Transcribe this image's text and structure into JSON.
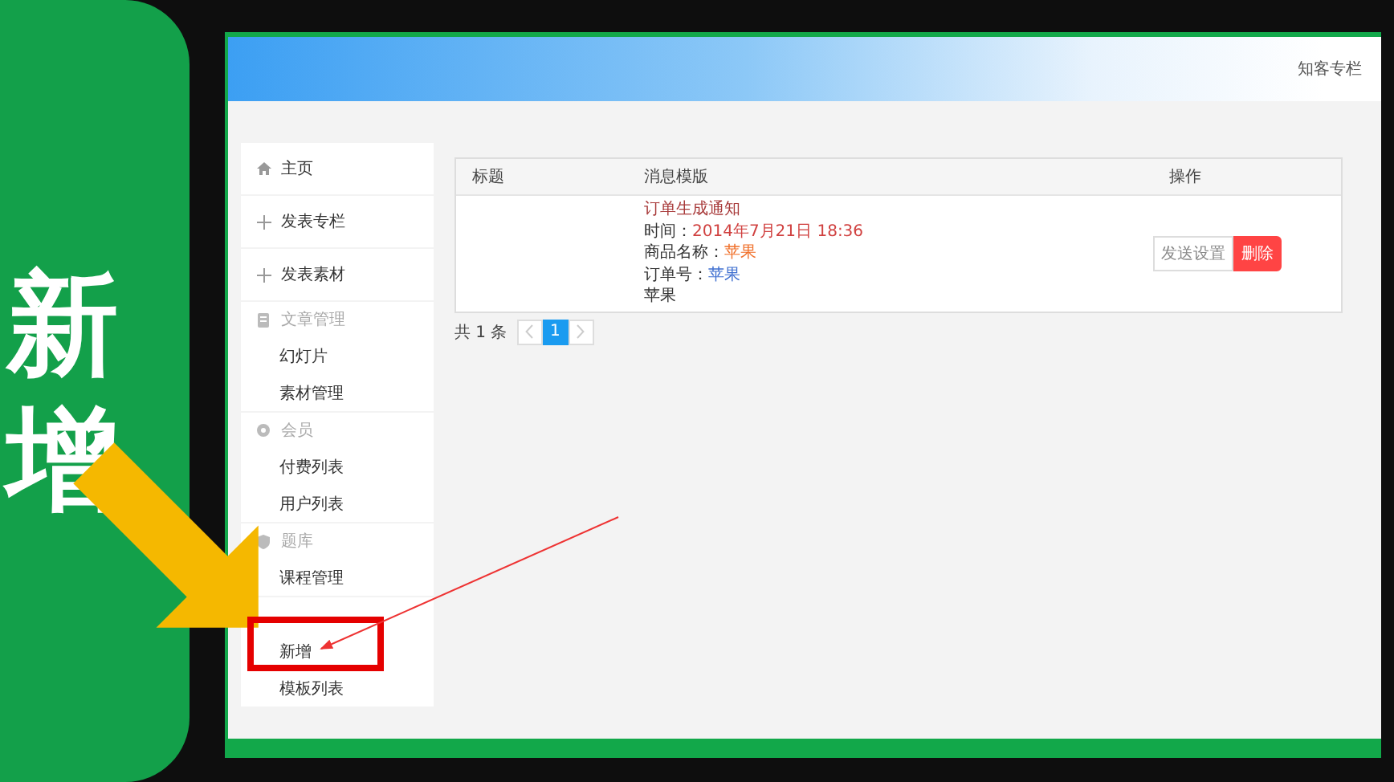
{
  "badge": {
    "text": "新增"
  },
  "header": {
    "site_name": "知客专栏"
  },
  "sidebar": {
    "items": [
      {
        "kind": "link",
        "label": "主页"
      },
      {
        "kind": "link",
        "label": "发表专栏"
      },
      {
        "kind": "link",
        "label": "发表素材"
      },
      {
        "kind": "group",
        "label": "文章管理",
        "children": [
          {
            "label": "幻灯片"
          },
          {
            "label": "素材管理"
          }
        ]
      },
      {
        "kind": "group",
        "label": "会员",
        "children": [
          {
            "label": "付费列表"
          },
          {
            "label": "用户列表"
          }
        ]
      },
      {
        "kind": "group",
        "label": "题库",
        "children": [
          {
            "label": "课程管理"
          }
        ]
      },
      {
        "kind": "group",
        "children": [
          {
            "label": "新增"
          },
          {
            "label": "模板列表"
          }
        ]
      }
    ]
  },
  "table": {
    "columns": [
      "标题",
      "消息模版",
      "操作"
    ],
    "rows": [
      {
        "template": [
          {
            "label": "订单生成通知",
            "color": "#a83a3a"
          },
          {
            "label": "时间：",
            "value": "2014年7月21日 18:36",
            "color": "#d0403f"
          },
          {
            "label": "商品名称：",
            "value": "苹果",
            "color": "#f0702a"
          },
          {
            "label": "订单号：",
            "value": "苹果",
            "color": "#3f6fd0"
          },
          {
            "label": "苹果",
            "color": "#333333"
          }
        ],
        "actions": [
          {
            "kind": "default",
            "label": "发送设置"
          },
          {
            "kind": "danger",
            "label": "删除"
          }
        ]
      }
    ]
  },
  "pagination": {
    "total": "共 1 条",
    "pages": [
      {
        "label": "1",
        "selected": true
      }
    ]
  }
}
